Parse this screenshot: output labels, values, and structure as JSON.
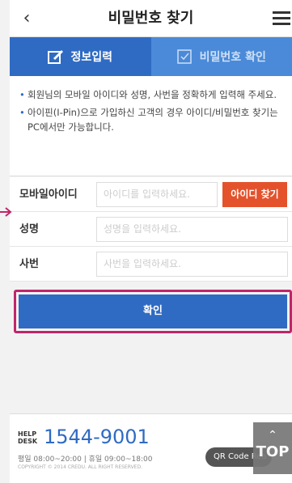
{
  "header": {
    "title": "비밀번호 찾기",
    "back_icon": "chevron-left-icon",
    "menu_icon": "hamburger-menu-icon"
  },
  "tabs": [
    {
      "label": "정보입력",
      "active": true,
      "icon": "edit-checkbox-icon"
    },
    {
      "label": "비밀번호 확인",
      "active": false,
      "icon": "checkbox-icon"
    }
  ],
  "info": [
    "회원님의 모바일 아이디와 성명, 사번을 정확하게 입력해 주세요.",
    "아이핀(I-Pin)으로 가입하신 고객의 경우 아이디/비밀번호 찾기는 PC에서만 가능합니다."
  ],
  "form": {
    "mobile_id": {
      "label": "모바일아이디",
      "placeholder": "아이디를 입력하세요.",
      "button": "아이디 찾기"
    },
    "name": {
      "label": "성명",
      "placeholder": "성명을 입력하세요."
    },
    "emp_no": {
      "label": "사번",
      "placeholder": "사번을 입력하세요."
    }
  },
  "confirm_label": "확인",
  "footer": {
    "help_label": "HELP DESK",
    "phone": "1544-9001",
    "hours": "평일 08:00~20:00  |  휴일 09:00~18:00",
    "copyright": "COPYRIGHT © 2014 CREDU. ALL RIGHT RESERVED.",
    "qr_label": "QR Code Rea",
    "top_label": "TOP"
  },
  "colors": {
    "primary": "#2f6bc3",
    "accent": "#e4522c",
    "highlight": "#c0256a"
  }
}
